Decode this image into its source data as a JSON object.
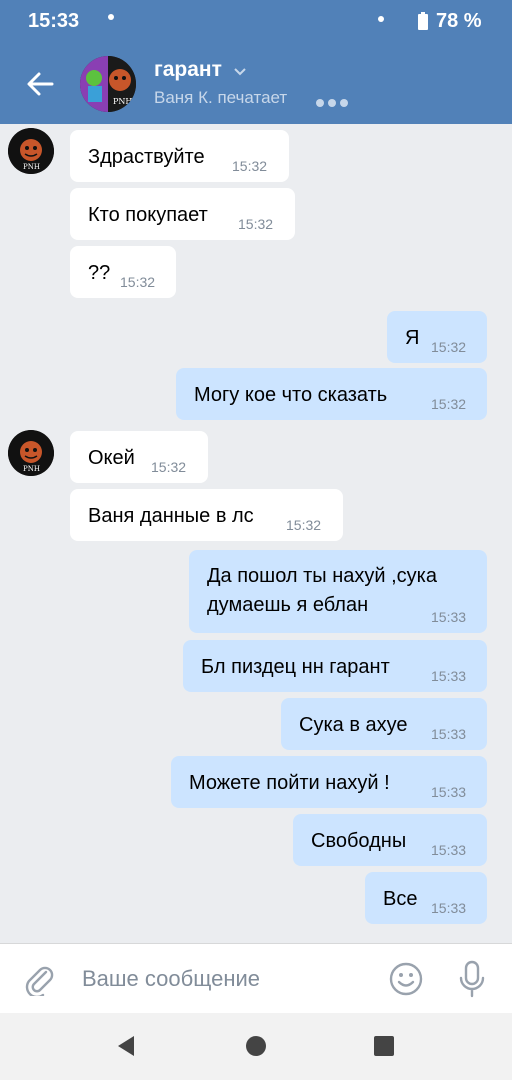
{
  "status_bar": {
    "time": "15:33",
    "battery": "78 %"
  },
  "header": {
    "title": "гарант",
    "subtitle": "Ваня К. печатает",
    "avatar_text": "PNH"
  },
  "messages": [
    {
      "text": "Здраствуйте",
      "time": "15:32"
    },
    {
      "text": "Кто покупает",
      "time": "15:32"
    },
    {
      "text": "??",
      "time": "15:32"
    },
    {
      "text": "Я",
      "time": "15:32"
    },
    {
      "text": "Могу кое что сказать",
      "time": "15:32"
    },
    {
      "text": "Окей",
      "time": "15:32"
    },
    {
      "text": "Ваня данные в лс",
      "time": "15:32"
    },
    {
      "text": "Да пошол ты нахуй ,сука",
      "text2": "думаешь я еблан",
      "time": "15:33"
    },
    {
      "text": "Бл пиздец нн гарант",
      "time": "15:33"
    },
    {
      "text": "Сука в ахуе",
      "time": "15:33"
    },
    {
      "text": "Можете пойти нахуй !",
      "time": "15:33"
    },
    {
      "text": "Свободны",
      "time": "15:33"
    },
    {
      "text": "Все",
      "time": "15:33"
    }
  ],
  "composer": {
    "placeholder": "Ваше сообщение"
  },
  "colors": {
    "header": "#5181b8",
    "incoming": "#ffffff",
    "outgoing": "#cce4ff",
    "background": "#ebedf0"
  },
  "icons": [
    "back-arrow-icon",
    "chevron-down-icon",
    "attach-icon",
    "smile-icon",
    "microphone-icon",
    "nav-back-icon",
    "nav-home-icon",
    "nav-recents-icon"
  ]
}
